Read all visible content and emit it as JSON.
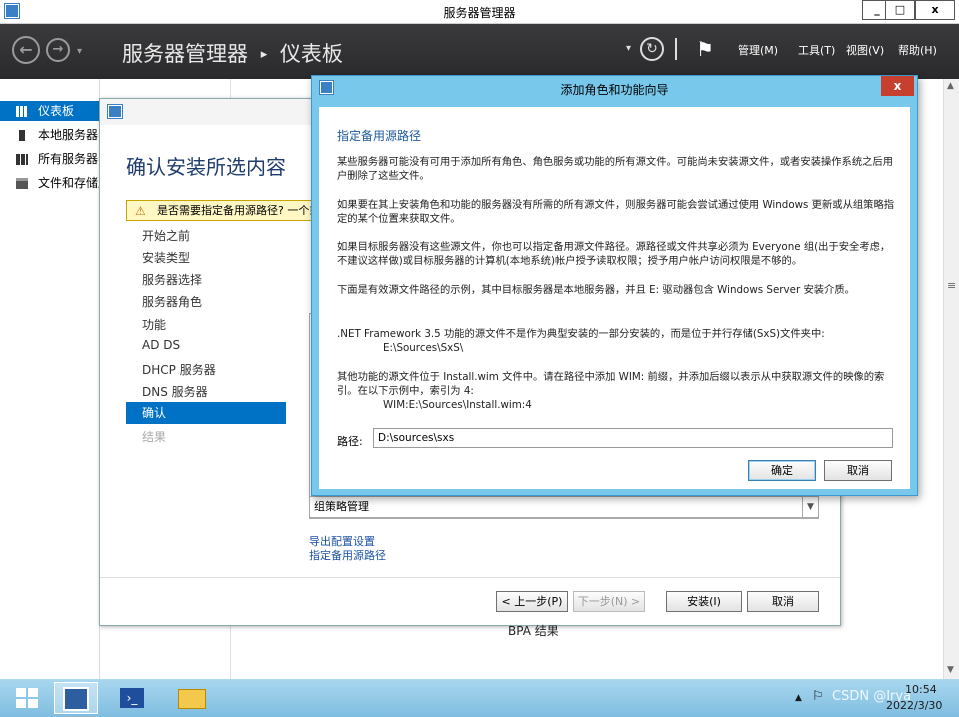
{
  "window": {
    "title": "服务器管理器",
    "minimize": "_",
    "maximize": "□",
    "close": "x"
  },
  "header": {
    "breadcrumb_app": "服务器管理器",
    "breadcrumb_sep": "▸",
    "breadcrumb_page": "仪表板",
    "menus": [
      "管理(M)",
      "工具(T)",
      "视图(V)",
      "帮助(H)"
    ]
  },
  "sidebar": {
    "items": [
      {
        "label": "仪表板",
        "icon": "dashboard-icon"
      },
      {
        "label": "本地服务器",
        "icon": "server-icon"
      },
      {
        "label": "所有服务器",
        "icon": "servers-icon"
      },
      {
        "label": "文件和存储服务",
        "icon": "storage-icon"
      }
    ]
  },
  "wizard": {
    "heading": "确认安装所选内容",
    "warning": "是否需要指定备用源路径? 一个或多个安装选择缺少源文件。",
    "steps": [
      "开始之前",
      "安装类型",
      "服务器选择",
      "服务器角色",
      "功能",
      "AD DS",
      "DHCP 服务器",
      "DNS 服务器",
      "确认",
      "结果"
    ],
    "selected_step": "确认",
    "list_last_item": "组策略管理",
    "links": [
      "导出配置设置",
      "指定备用源路径"
    ],
    "buttons": {
      "prev": "< 上一步(P)",
      "next": "下一步(N) >",
      "install": "安装(I)",
      "cancel": "取消"
    },
    "bpa_label": "BPA 结果"
  },
  "dialog": {
    "title": "添加角色和功能向导",
    "heading": "指定备用源路径",
    "paragraphs": [
      "某些服务器可能没有可用于添加所有角色、角色服务或功能的所有源文件。可能尚未安装源文件，或者安装操作系统之后用户删除了这些文件。",
      "如果要在其上安装角色和功能的服务器没有所需的所有源文件，则服务器可能会尝试通过使用 Windows 更新或从组策略指定的某个位置来获取文件。",
      "如果目标服务器没有这些源文件，你也可以指定备用源文件路径。源路径或文件共享必须为 Everyone 组(出于安全考虑，不建议这样做)或目标服务器的计算机(本地系统)帐户授予读取权限；授予用户帐户访问权限是不够的。",
      "下面是有效源文件路径的示例，其中目标服务器是本地服务器，并且 E: 驱动器包含 Windows Server 安装介质。",
      ".NET Framework 3.5 功能的源文件不是作为典型安装的一部分安装的，而是位于并行存储(SxS)文件夹中:",
      "E:\\Sources\\SxS\\",
      "其他功能的源文件位于 Install.wim 文件中。请在路径中添加 WIM: 前缀，并添加后缀以表示从中获取源文件的映像的索引。在以下示例中，索引为 4:",
      "WIM:E:\\Sources\\Install.wim:4"
    ],
    "path_label": "路径:",
    "path_value": "D:\\sources\\sxs",
    "ok": "确定",
    "cancel": "取消",
    "close": "x"
  },
  "taskbar": {
    "clock_time": "10:54",
    "clock_date": "2022/3/30",
    "watermark": "CSDN @Irya"
  },
  "colors": {
    "accent": "#0072c6",
    "dialog_frame": "#78c8ec",
    "header": "#2d2d30",
    "taskbar": "#8ec8e8",
    "close_red": "#c7402f"
  }
}
